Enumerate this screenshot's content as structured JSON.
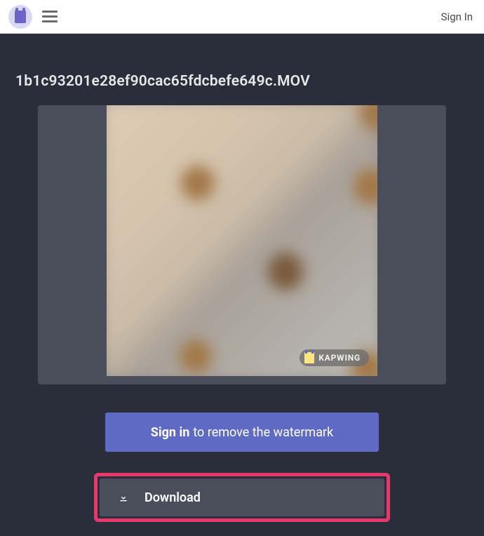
{
  "header": {
    "signin": "Sign In"
  },
  "file": {
    "title": "1b1c93201e28ef90cac65fdcbefe649c.MOV"
  },
  "watermark": {
    "brand": "KAPWING"
  },
  "banner": {
    "strong": "Sign in",
    "rest": " to remove the watermark"
  },
  "download": {
    "label": "Download"
  },
  "colors": {
    "accent_primary": "#5f6ac4",
    "highlight_border": "#e6396b",
    "panel_bg": "#4a4e5b",
    "page_bg": "#2a2e3b"
  }
}
